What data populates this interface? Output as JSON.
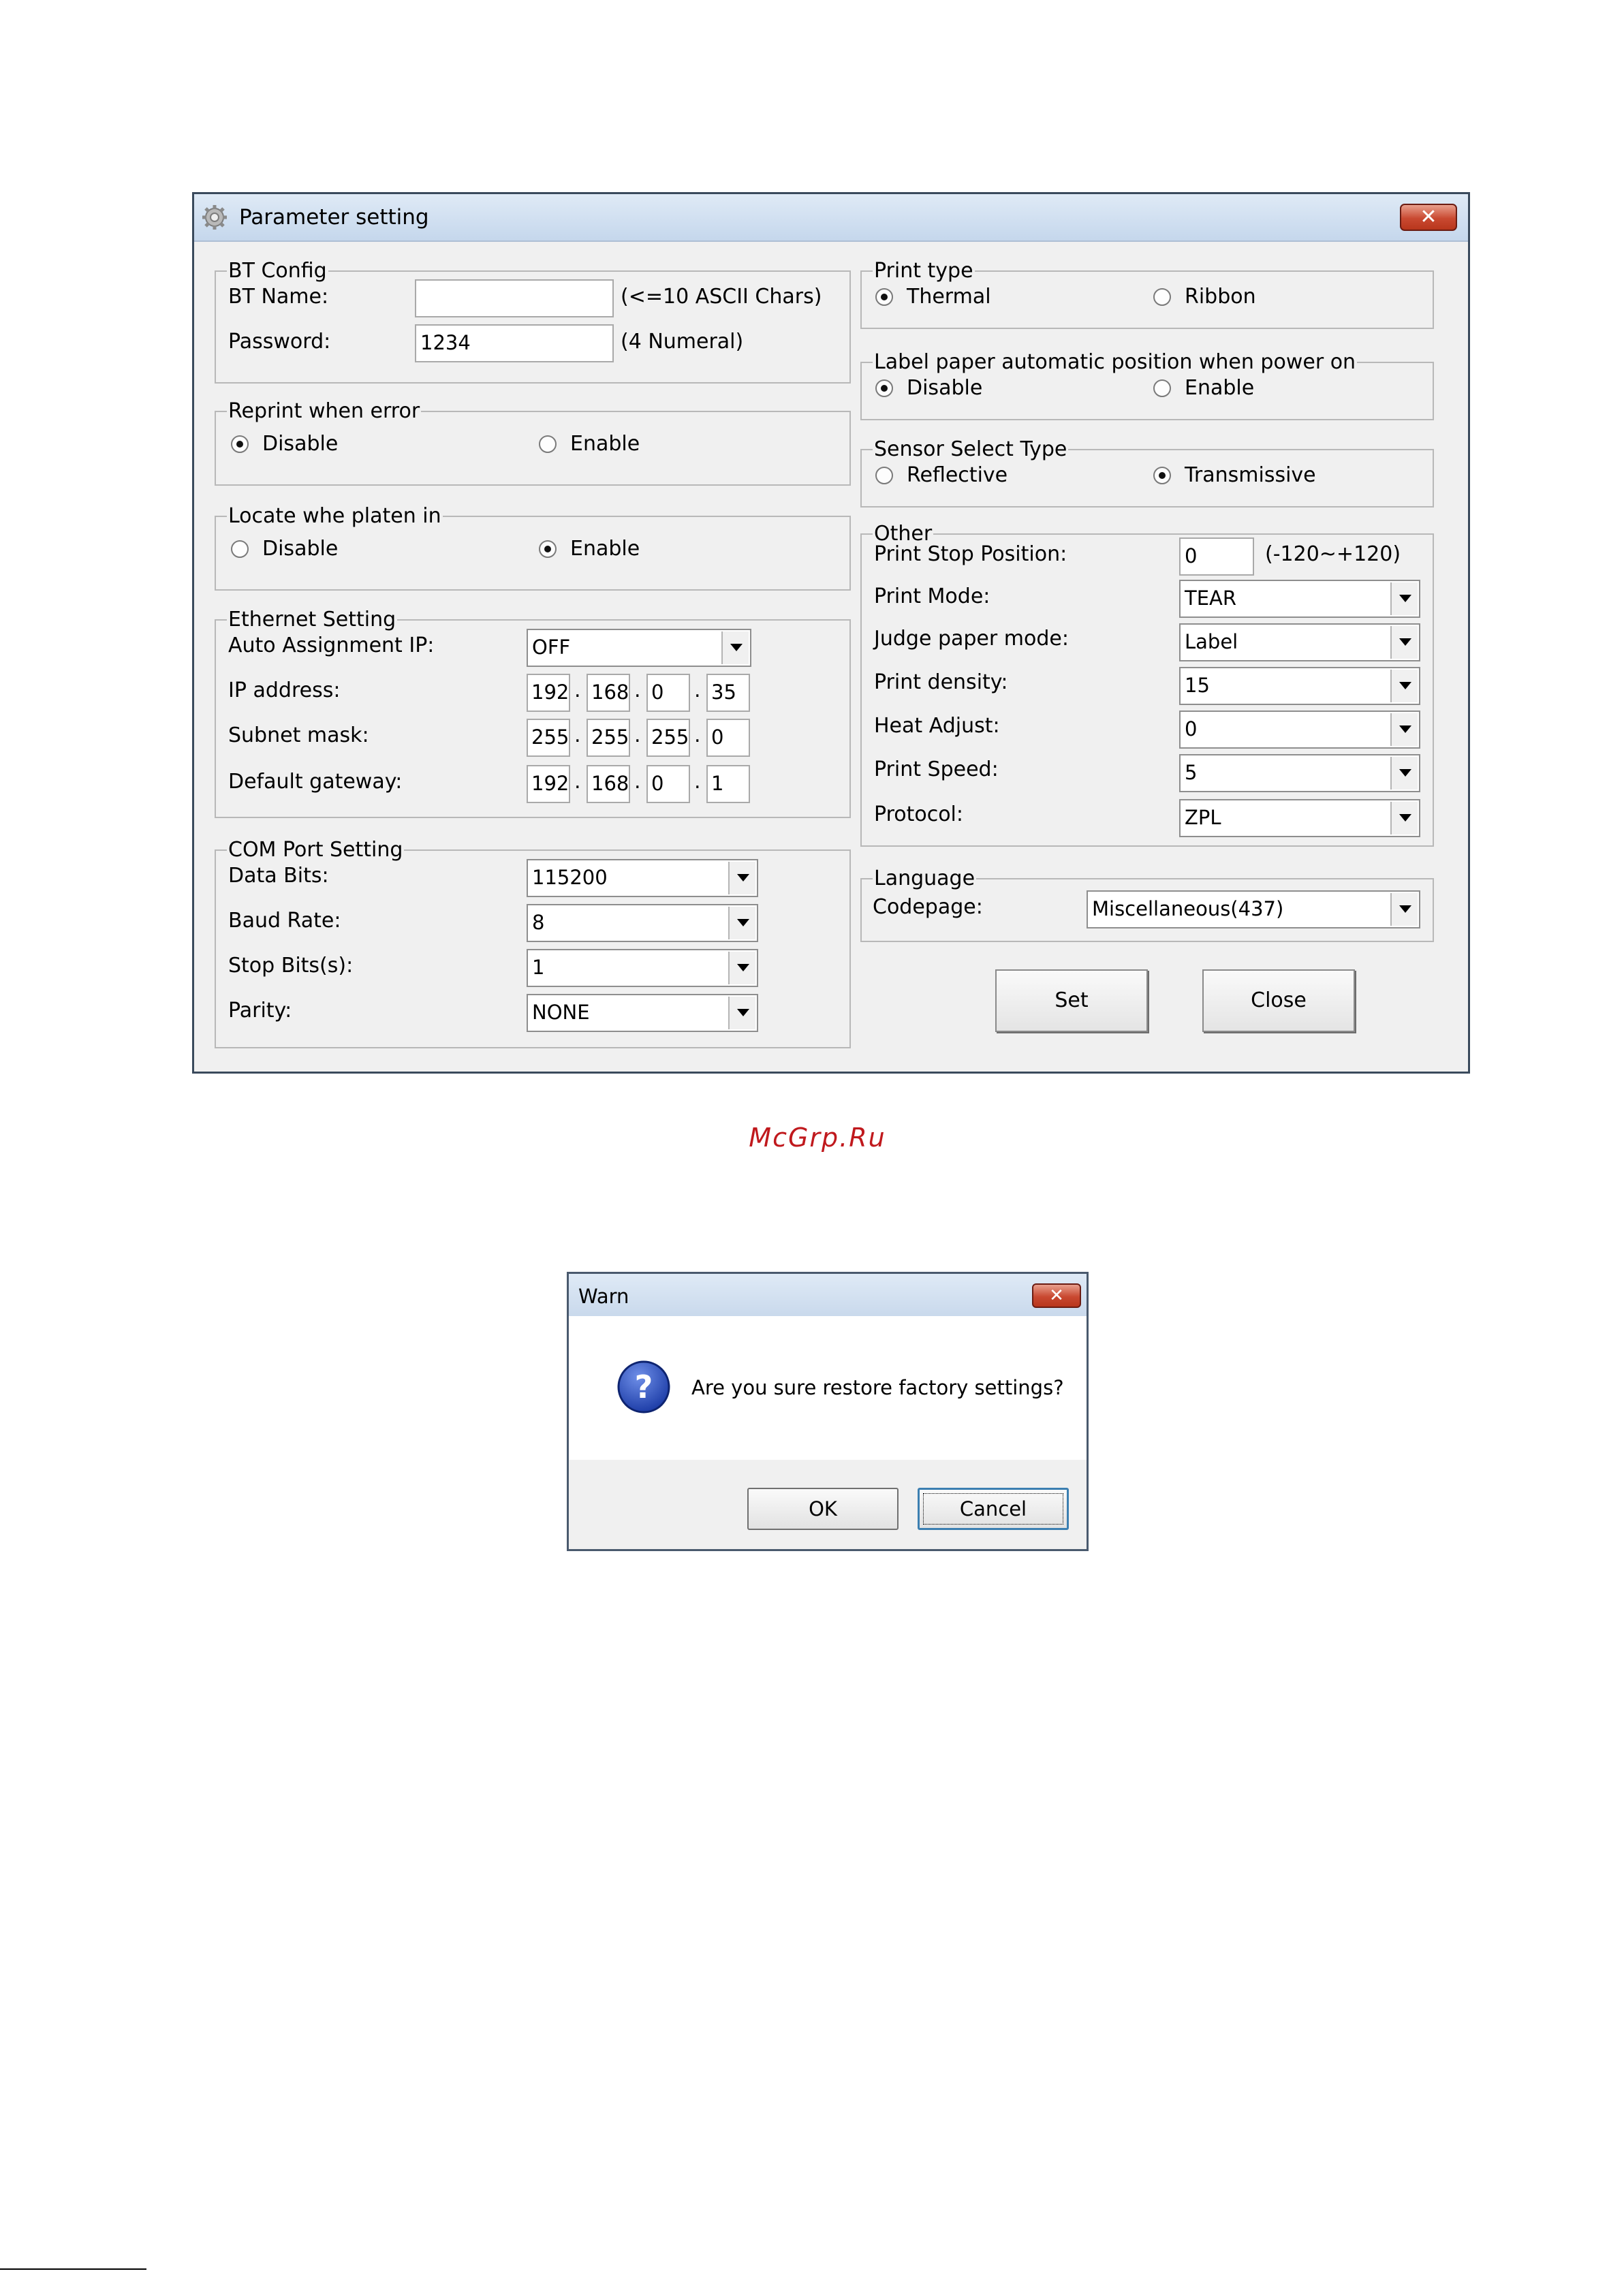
{
  "param_window": {
    "title": "Parameter setting",
    "close_glyph": "✕",
    "bt_config": {
      "legend": "BT Config",
      "name_label": "BT Name:",
      "name_value": "",
      "name_hint": "(<=10 ASCII Chars)",
      "password_label": "Password:",
      "password_value": "1234",
      "password_hint": "(4 Numeral)"
    },
    "reprint": {
      "legend": "Reprint when error",
      "disable": "Disable",
      "enable": "Enable",
      "selected": "Disable"
    },
    "locate": {
      "legend": "Locate whe platen in",
      "disable": "Disable",
      "enable": "Enable",
      "selected": "Enable"
    },
    "ethernet": {
      "legend": "Ethernet Setting",
      "auto_label": "Auto Assignment IP:",
      "auto_value": "OFF",
      "ip_label": "IP address:",
      "ip": [
        "192",
        "168",
        "0",
        "35"
      ],
      "subnet_label": "Subnet mask:",
      "subnet": [
        "255",
        "255",
        "255",
        "0"
      ],
      "gateway_label": "Default gateway:",
      "gateway": [
        "192",
        "168",
        "0",
        "1"
      ],
      "separator": "."
    },
    "com": {
      "legend": "COM Port Setting",
      "databits_label": "Data Bits:",
      "databits_value": "115200",
      "baud_label": "Baud Rate:",
      "baud_value": "8",
      "stop_label": "Stop Bits(s):",
      "stop_value": "1",
      "parity_label": "Parity:",
      "parity_value": "NONE"
    },
    "print_type": {
      "legend": "Print type",
      "thermal": "Thermal",
      "ribbon": "Ribbon",
      "selected": "Thermal"
    },
    "label_position": {
      "legend": "Label paper automatic position when power on",
      "disable": "Disable",
      "enable": "Enable",
      "selected": "Disable"
    },
    "sensor": {
      "legend": "Sensor Select Type",
      "reflective": "Reflective",
      "transmissive": "Transmissive",
      "selected": "Transmissive"
    },
    "other": {
      "legend": "Other",
      "stop_pos_label": "Print Stop Position:",
      "stop_pos_value": "0",
      "stop_pos_hint": "(-120~+120)",
      "mode_label": "Print Mode:",
      "mode_value": "TEAR",
      "judge_label": "Judge paper mode:",
      "judge_value": "Label",
      "density_label": "Print density:",
      "density_value": "15",
      "heat_label": "Heat Adjust:",
      "heat_value": "0",
      "speed_label": "Print Speed:",
      "speed_value": "5",
      "protocol_label": "Protocol:",
      "protocol_value": "ZPL"
    },
    "language": {
      "legend": "Language",
      "codepage_label": "Codepage:",
      "codepage_value": "Miscellaneous(437)"
    },
    "buttons": {
      "set": "Set",
      "close": "Close"
    }
  },
  "watermark": "McGrp.Ru",
  "warn_dialog": {
    "title": "Warn",
    "close_glyph": "✕",
    "icon": "question-icon",
    "icon_glyph": "?",
    "message": "Are you sure restore factory settings?",
    "ok": "OK",
    "cancel": "Cancel"
  }
}
